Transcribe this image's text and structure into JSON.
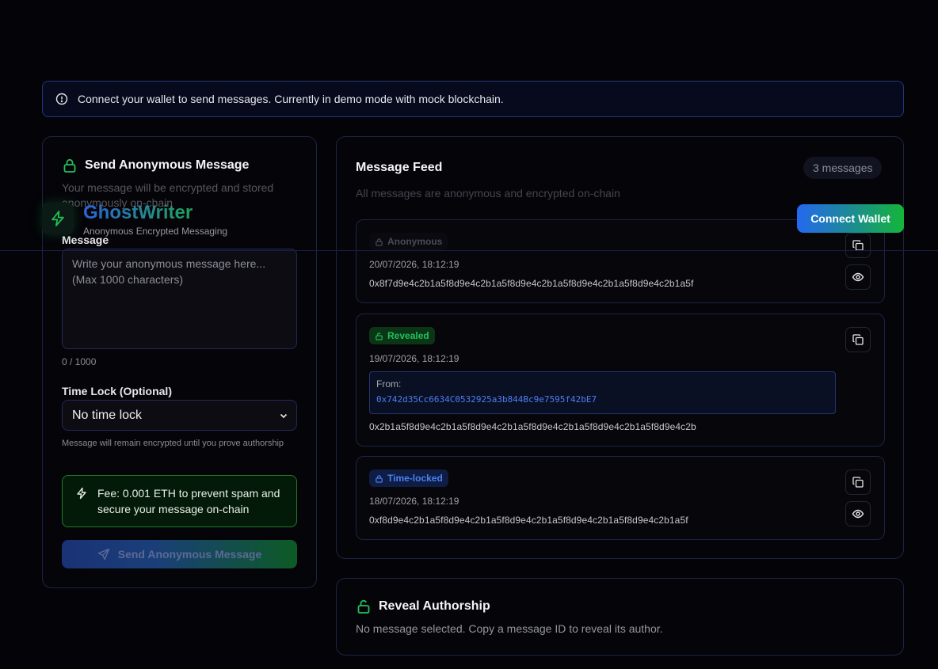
{
  "banner": {
    "text": "Connect your wallet to send messages. Currently in demo mode with mock blockchain."
  },
  "header": {
    "brand": "GhostWriter",
    "tagline": "Anonymous Encrypted Messaging",
    "connect_label": "Connect Wallet"
  },
  "send": {
    "title": "Send Anonymous Message",
    "subtitle": "Your message will be encrypted and stored anonymously on-chain",
    "message_label": "Message",
    "message_value": "",
    "message_placeholder": "Write your anonymous message here... (Max 1000 characters)",
    "counter": "0 / 1000",
    "timelock_label": "Time Lock (Optional)",
    "timelock_value": "No time lock",
    "timelock_hint": "Message will remain encrypted until you prove authorship",
    "fee_text": "Fee: 0.001 ETH to prevent spam and secure your message on-chain",
    "send_label": "Send Anonymous Message"
  },
  "feed": {
    "title": "Message Feed",
    "subtitle": "All messages are anonymous and encrypted on-chain",
    "count": "3 messages",
    "messages": [
      {
        "badge": "Anonymous",
        "time": "20/07/2026, 18:12:19",
        "hash": "0x8f7d9e4c2b1a5f8d9e4c2b1a5f8d9e4c2b1a5f8d9e4c2b1a5f8d9e4c2b1a5f"
      },
      {
        "badge": "Revealed",
        "time": "19/07/2026, 18:12:19",
        "from_label": "From:",
        "from_address": "0x742d35Cc6634C0532925a3b844Bc9e7595f42bE7",
        "hash": "0x2b1a5f8d9e4c2b1a5f8d9e4c2b1a5f8d9e4c2b1a5f8d9e4c2b1a5f8d9e4c2b"
      },
      {
        "badge": "Time-locked",
        "time": "18/07/2026, 18:12:19",
        "hash": "0xf8d9e4c2b1a5f8d9e4c2b1a5f8d9e4c2b1a5f8d9e4c2b1a5f8d9e4c2b1a5f"
      }
    ]
  },
  "reveal": {
    "title": "Reveal Authorship",
    "subtitle": "No message selected. Copy a message ID to reveal its author."
  },
  "colors": {
    "accent_blue": "#2468f0",
    "accent_green": "#14b53a",
    "border": "#1c2444"
  },
  "icons": {
    "banner": "info-circle-icon",
    "send_title": "lock-icon",
    "logo": "lightning-icon",
    "fee": "lightning-icon",
    "send_button": "send-plane-icon",
    "copy": "copy-icon",
    "view": "eye-icon",
    "reveal_title": "unlock-icon"
  }
}
